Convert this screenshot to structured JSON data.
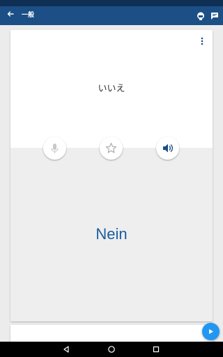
{
  "app_bar": {
    "title": "一般",
    "back_icon": "arrow-left-icon",
    "actions": [
      "quiz-icon",
      "chat-icon"
    ]
  },
  "card": {
    "front_text": "いいえ",
    "back_text": "Nein",
    "menu_icon": "more-vertical-icon",
    "buttons": [
      "microphone-icon",
      "star-icon",
      "speaker-icon"
    ]
  },
  "colors": {
    "app_bar": "#1b4f86",
    "status_bar": "#0f2f55",
    "accent_text": "#1b5ea0",
    "fab": "#2196f3"
  },
  "fab": {
    "icon": "play-icon"
  },
  "nav_bar": {
    "buttons": [
      "back-triangle-icon",
      "home-circle-icon",
      "recents-square-icon"
    ]
  }
}
